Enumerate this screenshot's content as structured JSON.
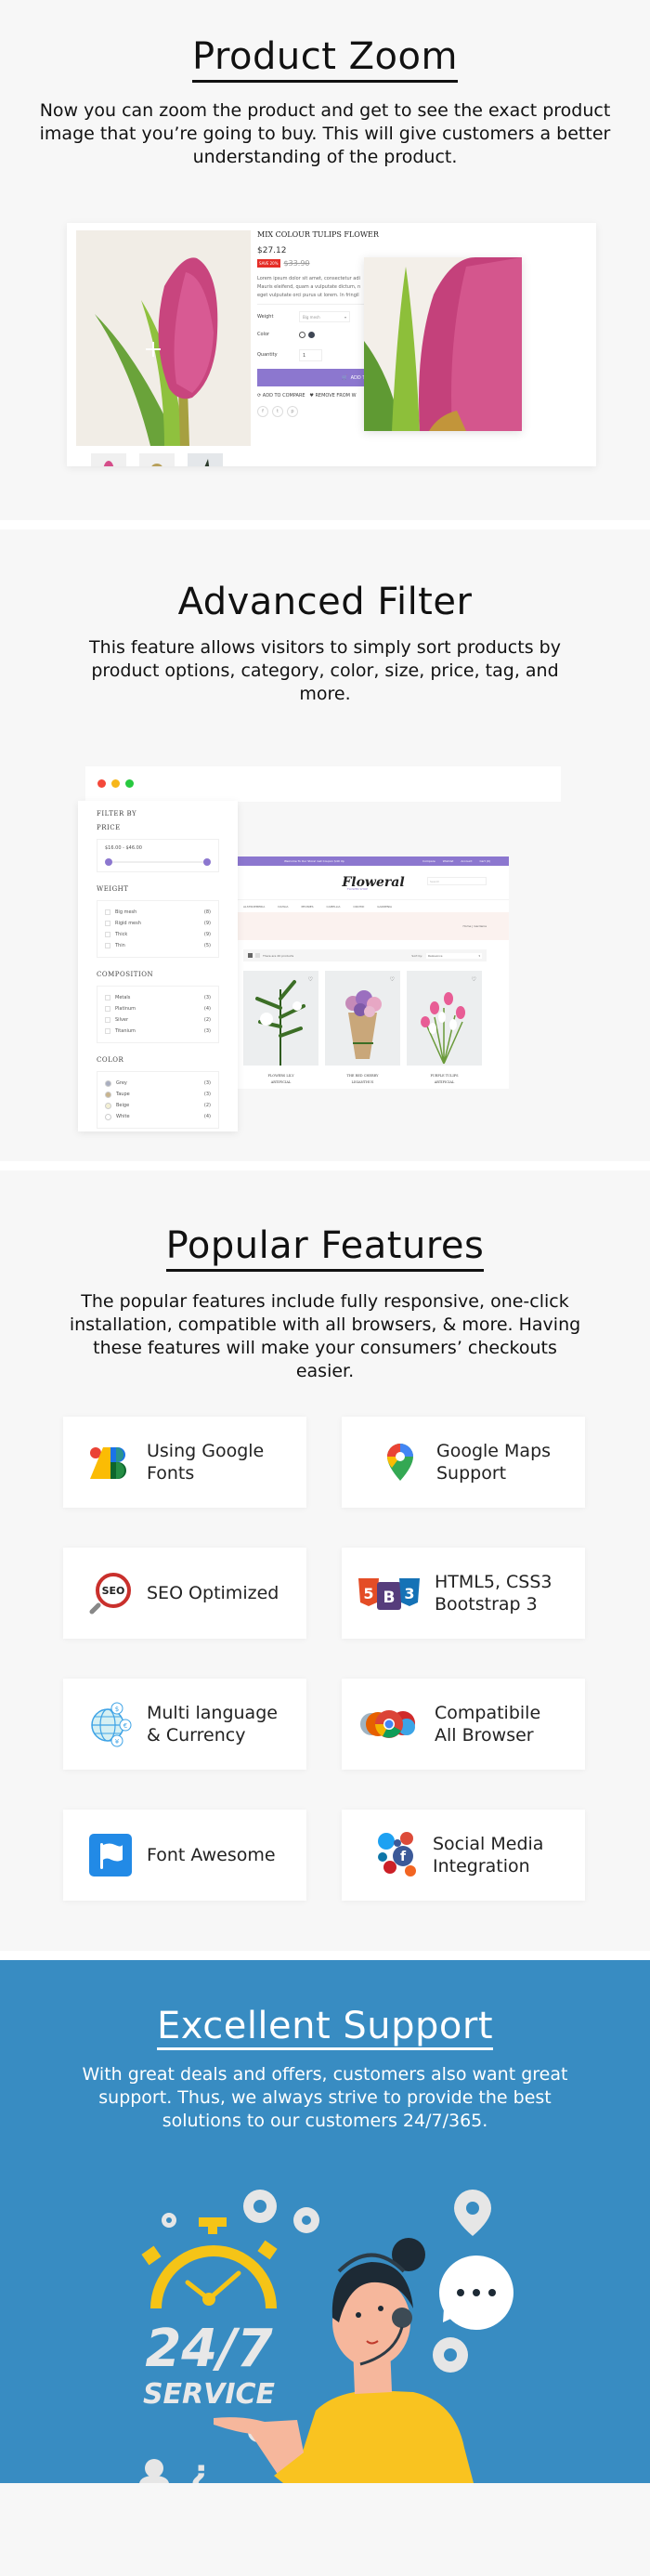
{
  "product_zoom": {
    "title": "Product Zoom",
    "description": "Now you can zoom the product and get to see the exact product image that you’re going to buy. This will give customers a better understanding of the product.",
    "demo": {
      "product_name": "MIX COLOUR TULIPS FLOWER",
      "price": "$27.12",
      "save_badge": "SAVE 20%",
      "old_price": "$33.90",
      "description_lines": [
        "Lorem ipsum dolor sit amet, consectetur adi",
        "Mauris eleifend, quam a vulputate dictum, n",
        "eget vulputate orci purus ut lorem. In fringil"
      ],
      "weight_label": "Weight",
      "weight_value": "Big mesh",
      "color_label": "Color",
      "quantity_label": "Quantity",
      "quantity_value": "1",
      "add_to_cart": "ADD TO CART",
      "add_to_compare": "ADD TO COMPARE",
      "remove_from_wishlist": "REMOVE FROM W",
      "social": [
        "f",
        "t",
        "p"
      ],
      "accent_color": "#8c77cf",
      "badge_color": "#e52d27"
    }
  },
  "advanced_filter": {
    "title": "Advanced Filter",
    "description": "This feature allows visitors to simply sort products by product options, category, color, size, price, tag, and more.",
    "window_dots": [
      "#f4483a",
      "#f6b61a",
      "#27c93f"
    ],
    "filter_panel": {
      "heading": "FILTER BY",
      "price_heading": "PRICE",
      "price_range": "$16.00 - $46.00",
      "weight_heading": "WEIGHT",
      "weight_options": [
        {
          "label": "Big mesh",
          "count": "(8)"
        },
        {
          "label": "Rigid mesh",
          "count": "(9)"
        },
        {
          "label": "Thick",
          "count": "(9)"
        },
        {
          "label": "Thin",
          "count": "(5)"
        }
      ],
      "composition_heading": "COMPOSITION",
      "composition_options": [
        {
          "label": "Metals",
          "count": "(3)"
        },
        {
          "label": "Platinum",
          "count": "(4)"
        },
        {
          "label": "Silver",
          "count": "(2)"
        },
        {
          "label": "Titanium",
          "count": "(3)"
        }
      ],
      "color_heading": "COLOR",
      "color_options": [
        {
          "label": "Grey",
          "count": "(3)",
          "swatch": "#a9aec0"
        },
        {
          "label": "Taupe",
          "count": "(3)",
          "swatch": "#c8b48e"
        },
        {
          "label": "Beige",
          "count": "(2)",
          "swatch": "#f3efd4"
        },
        {
          "label": "White",
          "count": "(4)",
          "swatch": "#ffffff"
        }
      ]
    },
    "shop": {
      "topbar_text": "Welcome To Our Store! Get Coupon $40 Up",
      "topbar_links": [
        "Compare",
        "Wishlist",
        "Account",
        "Cart (0)"
      ],
      "brand": "Floweral",
      "brand_sub": "FLOWER SHOP",
      "search_placeholder": "Search",
      "nav": [
        "ALSTROEMERIA",
        "DAHLIA",
        "PEONIES",
        "CAMELLIA",
        "ORCHID",
        "GARDENIA"
      ],
      "breadcrumb": "Home | Gardenia",
      "product_count": "There are 20 products",
      "sort_label": "Sort by:",
      "sort_value": "Relevance",
      "products": [
        {
          "name_line1": "FLOWERS LILY",
          "name_line2": "ARTIFICIAL"
        },
        {
          "name_line1": "THE RED CHERRY",
          "name_line2": "LISIANTHUS"
        },
        {
          "name_line1": "PURPLE TULIPS",
          "name_line2": "ARTIFICIAL"
        }
      ]
    }
  },
  "popular_features": {
    "title": "Popular Features",
    "description": "The popular features include  fully responsive, one-click installation, compatible with all browsers, & more. Having these features will make your consumers’ checkouts easier.",
    "items": [
      {
        "label": "Using Google\nFonts",
        "icon": "google-fonts-icon"
      },
      {
        "label": "Google Maps\nSupport",
        "icon": "google-maps-icon"
      },
      {
        "label": "SEO Optimized",
        "icon": "seo-icon"
      },
      {
        "label": "HTML5, CSS3\nBootstrap 3",
        "icon": "html5-css3-bootstrap-icon"
      },
      {
        "label": "Multi language\n& Currency",
        "icon": "globe-currency-icon"
      },
      {
        "label": "Compatibile\nAll Browser",
        "icon": "browsers-icon"
      },
      {
        "label": "Font Awesome",
        "icon": "font-awesome-flag-icon"
      },
      {
        "label": "Social Media\nIntegration",
        "icon": "social-media-icon"
      }
    ]
  },
  "excellent_support": {
    "title": "Excellent Support",
    "description": "With great deals and offers, customers also want great support. Thus, we always strive to provide the best solutions to our customers 24/7/365.",
    "illustration_text_big": "24/7",
    "illustration_text_small": "SERVICE",
    "background_color": "#388cc2"
  }
}
